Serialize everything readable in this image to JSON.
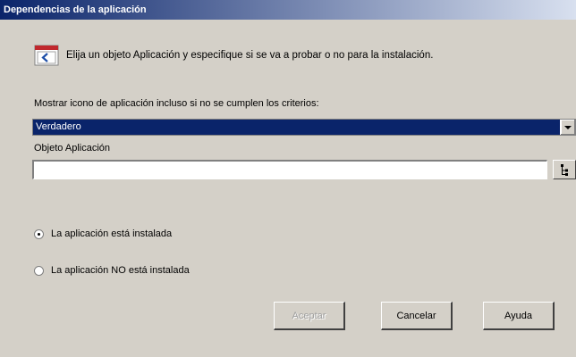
{
  "window": {
    "title": "Dependencias de la aplicación",
    "title_color_start": "#0a246a",
    "title_color_end": "#d8e0ef"
  },
  "instructions": {
    "icon": "application-window-icon",
    "text": "Elija un objeto Aplicación y especifique si se va a probar o no para la instalación."
  },
  "show_icon": {
    "label": "Mostrar icono de aplicación incluso si no se cumplen los criterios:",
    "selected": "Verdadero"
  },
  "app_object": {
    "label": "Objeto Aplicación",
    "value": "",
    "browse_icon": "browse-tree-icon"
  },
  "radios": [
    {
      "label": "La aplicación está instalada",
      "checked": true
    },
    {
      "label": "La aplicación NO está instalada",
      "checked": false
    }
  ],
  "buttons": {
    "accept": "Aceptar",
    "cancel": "Cancelar",
    "help": "Ayuda"
  }
}
